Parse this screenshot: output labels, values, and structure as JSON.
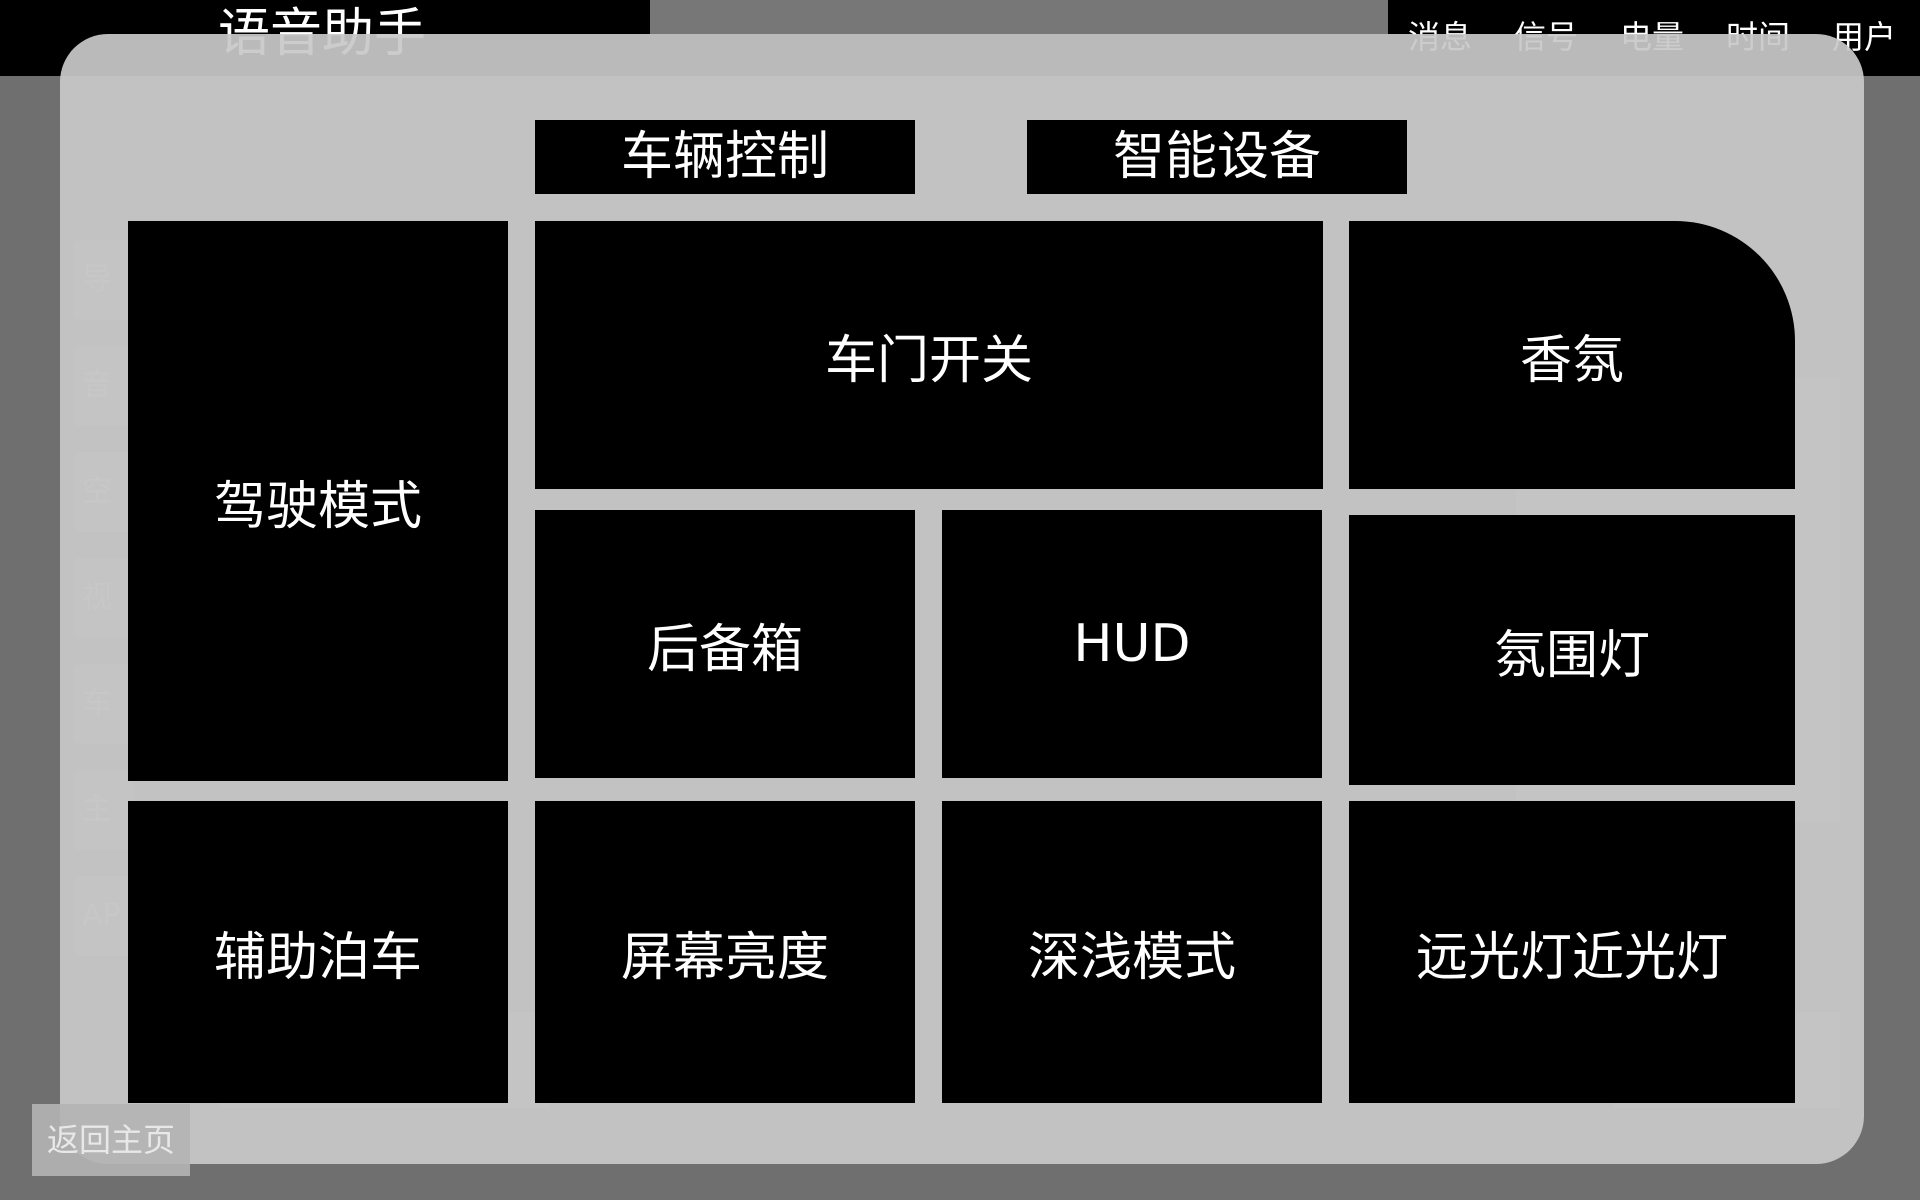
{
  "header": {
    "title": "语音助手",
    "status": [
      "消息",
      "信号",
      "电量",
      "时间",
      "用户"
    ]
  },
  "background": {
    "list_items": [
      "导",
      "音",
      "空",
      "视",
      "车",
      "主",
      "AP"
    ]
  },
  "tabs": [
    {
      "label": "车辆控制"
    },
    {
      "label": "智能设备"
    }
  ],
  "tiles": {
    "drive_mode": "驾驶模式",
    "door_switch": "车门开关",
    "fragrance": "香氛",
    "trunk": "后备箱",
    "hud": "HUD",
    "ambient_light": "氛围灯",
    "park_assist": "辅助泊车",
    "screen_brightness": "屏幕亮度",
    "dark_light_mode": "深浅模式",
    "high_low_beam": "远光灯近光灯"
  },
  "footer": {
    "home_label": "返回主页"
  }
}
